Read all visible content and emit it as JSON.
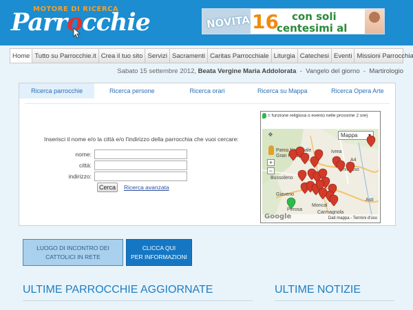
{
  "header": {
    "logo_sub": "MOTORE DI RICERCA",
    "logo_main_a": "Parr",
    "logo_main_b": "o",
    "logo_main_c": "cchie"
  },
  "banner": {
    "badge": "NOVITÀ",
    "number": "16",
    "line1": "con soli",
    "line2": "centesimi al giorno!"
  },
  "nav": {
    "items": [
      "Home",
      "Tutto su Parrocchie.it",
      "Crea il tuo sito",
      "Servizi",
      "Sacramenti",
      "Caritas Parrocchiale",
      "Liturgia",
      "Catechesi",
      "Eventi",
      "Missioni Parrocchiali"
    ]
  },
  "dateline": {
    "date": "Sabato 15 settembre 2012,",
    "saint": "Beata Vergine Maria Addolorata",
    "sep1": "-",
    "gospel": "Vangelo del giorno",
    "sep2": "-",
    "martyrology": "Martirologio"
  },
  "tabs": [
    "Ricerca parrocchie",
    "Ricerca persone",
    "Ricerca orari",
    "Ricerca su Mappa",
    "Ricerca Opera Arte"
  ],
  "form": {
    "intro": "Inserisci il nome e/o la città e/o l'indirizzo della parrocchia che vuoi cercare:",
    "name_label": "nome:",
    "city_label": "città:",
    "address_label": "indirizzo:",
    "name_value": "",
    "city_value": "",
    "address_value": "",
    "search_button": "Cerca",
    "advanced_link": "Ricerca avanzata"
  },
  "map": {
    "legend": "= funzione religiosa o evento nelle prossime 2 ore)",
    "type_select": "Mappa",
    "zoom_in": "+",
    "zoom_out": "−",
    "labels": {
      "park": "Parco Nazionale",
      "park2": "Gran Paradiso",
      "bussoleno": "Bussoleno",
      "giaveno": "Giaveno",
      "moncalieri": "Moncal",
      "carmagnola": "Carmagnola",
      "ivrea": "Ivrea",
      "chivasso": "Chivasso",
      "asti": "Asti",
      "perosa": "Perosa",
      "road": "A4"
    },
    "google": "Google",
    "footer": "Dati mappa - Termini d'uso"
  },
  "promos": {
    "left_l1": "LUOGO DI INCONTRO DEI",
    "left_l2": "CATTOLICI IN RETE",
    "right_l1": "CLICCA QUI",
    "right_l2": "PER INFORMAZIONI"
  },
  "sections": {
    "left_title": "ULTIME PARROCCHIE AGGIORNATE",
    "right_title": "ULTIME NOTIZIE"
  },
  "colors": {
    "header_bg": "#1b8dd0",
    "accent_blue": "#1b7fc4",
    "pin_red": "#d23a2a",
    "pin_green": "#2fb84b"
  }
}
